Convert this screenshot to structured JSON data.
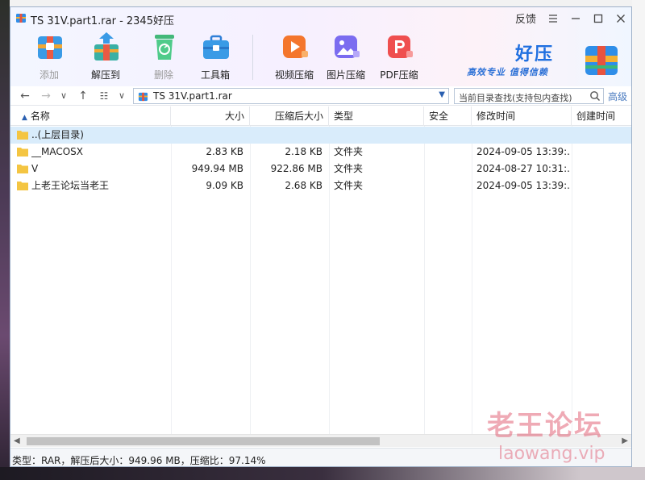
{
  "window": {
    "title": "TS 31V.part1.rar - 2345好压",
    "feedback_label": "反馈"
  },
  "toolbar": {
    "items": [
      {
        "label": "添加",
        "icon": "add-archive-icon",
        "enabled": false
      },
      {
        "label": "解压到",
        "icon": "extract-icon",
        "enabled": true
      },
      {
        "label": "删除",
        "icon": "recycle-delete-icon",
        "enabled": false
      },
      {
        "label": "工具箱",
        "icon": "toolbox-icon",
        "enabled": true
      },
      {
        "label": "视频压缩",
        "icon": "video-compress-icon",
        "enabled": true
      },
      {
        "label": "图片压缩",
        "icon": "image-compress-icon",
        "enabled": true
      },
      {
        "label": "PDF压缩",
        "icon": "pdf-compress-icon",
        "enabled": true
      }
    ]
  },
  "brand": {
    "name": "好压",
    "slogan": "高效专业 值得信赖"
  },
  "navbar": {
    "path": "TS 31V.part1.rar",
    "search_placeholder": "当前目录查找(支持包内查找)",
    "advanced_label": "高级"
  },
  "columns": [
    "名称",
    "大小",
    "压缩后大小",
    "类型",
    "安全",
    "修改时间",
    "创建时间"
  ],
  "rows": [
    {
      "name": "..(上层目录)",
      "size": "",
      "packed": "",
      "type": "",
      "security": "",
      "modified": "",
      "created": "",
      "selected": true
    },
    {
      "name": "__MACOSX",
      "size": "2.83 KB",
      "packed": "2.18 KB",
      "type": "文件夹",
      "security": "",
      "modified": "2024-09-05 13:39:...",
      "created": "",
      "selected": false
    },
    {
      "name": "V",
      "size": "949.94 MB",
      "packed": "922.86 MB",
      "type": "文件夹",
      "security": "",
      "modified": "2024-08-27 10:31:...",
      "created": "",
      "selected": false
    },
    {
      "name": "上老王论坛当老王",
      "size": "9.09 KB",
      "packed": "2.68 KB",
      "type": "文件夹",
      "security": "",
      "modified": "2024-09-05 13:39:...",
      "created": "",
      "selected": false
    }
  ],
  "status": "类型：RAR，解压后大小：949.96 MB，压缩比：97.14%",
  "watermark": {
    "text": "老王论坛",
    "domain": "laowang.vip"
  },
  "colors": {
    "selection": "#d9ecfb",
    "folder": "#f4c542",
    "brand_blue": "#1f6fe0"
  }
}
